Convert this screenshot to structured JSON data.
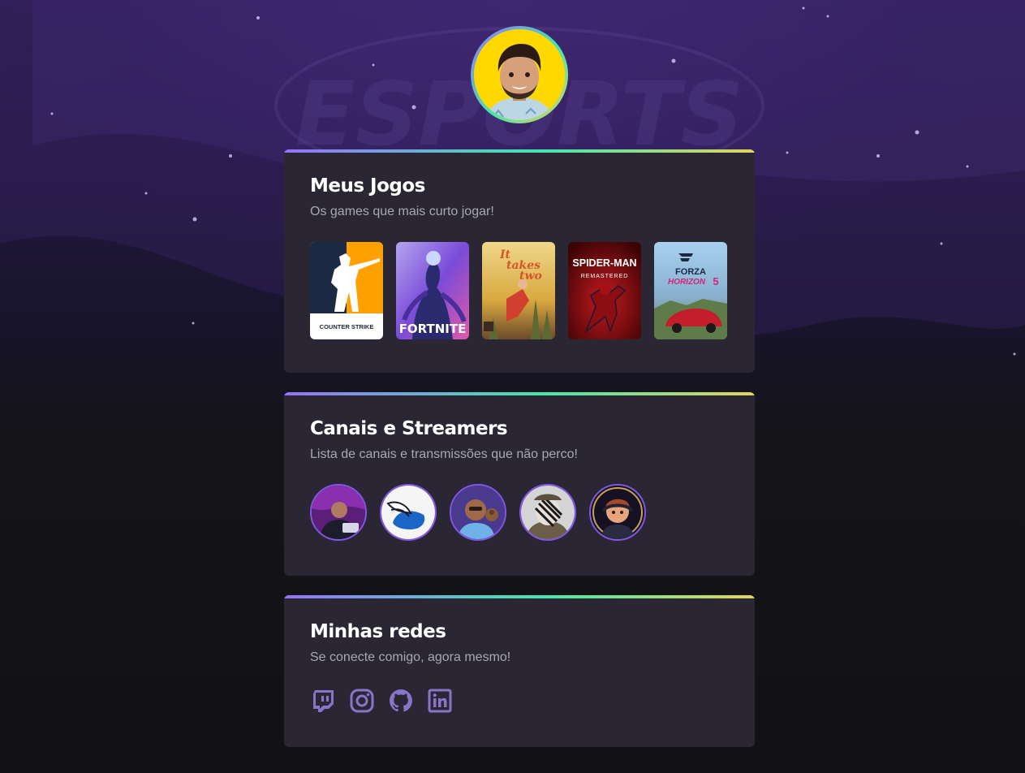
{
  "background": {
    "watermark": "ESPORTS"
  },
  "profile": {
    "avatar_icon": "profile-photo"
  },
  "games_section": {
    "title": "Meus Jogos",
    "subtitle": "Os games que mais curto jogar!",
    "games": [
      {
        "name": "Counter-Strike",
        "cover_text": "COUNTER STRIKE",
        "colors": [
          "#fea100",
          "#1c2a44"
        ]
      },
      {
        "name": "Fortnite",
        "cover_text": "FORTNITE",
        "colors": [
          "#7a4bd8",
          "#e05aa8"
        ]
      },
      {
        "name": "It Takes Two",
        "cover_text_1": "It",
        "cover_text_2": "takes",
        "cover_text_3": "two",
        "colors": [
          "#e9c24a",
          "#7a5a34"
        ]
      },
      {
        "name": "Spider-Man Remastered",
        "cover_text": "SPIDER-MAN",
        "cover_subtext": "REMASTERED",
        "colors": [
          "#9d0a0c",
          "#3a0305"
        ]
      },
      {
        "name": "Forza Horizon 5",
        "cover_text": "FORZA",
        "cover_subtext": "HORIZON",
        "cover_number": "5",
        "colors": [
          "#6ea7d8",
          "#c41d2c"
        ]
      }
    ]
  },
  "streamers_section": {
    "title": "Canais e Streamers",
    "subtitle": "Lista de canais e transmissões que não perco!",
    "streamers": [
      {
        "icon": "streamer-avatar-1",
        "bg": "#5b1f7a"
      },
      {
        "icon": "winged-helmet-avatar",
        "bg": "#ffffff"
      },
      {
        "icon": "streamer-avatar-3",
        "bg": "#4a3a8e"
      },
      {
        "icon": "streamer-avatar-4",
        "bg": "#cfcfcf"
      },
      {
        "icon": "streamer-avatar-5",
        "bg": "#151022"
      }
    ]
  },
  "social_section": {
    "title": "Minhas redes",
    "subtitle": "Se conecte comigo, agora mesmo!",
    "links": [
      {
        "network": "Twitch",
        "icon": "twitch-icon"
      },
      {
        "network": "Instagram",
        "icon": "instagram-icon"
      },
      {
        "network": "GitHub",
        "icon": "github-icon"
      },
      {
        "network": "LinkedIn",
        "icon": "linkedin-icon"
      }
    ],
    "icon_color": "#8a74c8"
  },
  "colors": {
    "card_bg": "#2a2634",
    "accent_gradient": [
      "#9572fc",
      "#43e7ad",
      "#e2d45c"
    ],
    "title": "#ffffff",
    "subtitle": "#a8a8b3",
    "ring": "#8257e5"
  }
}
